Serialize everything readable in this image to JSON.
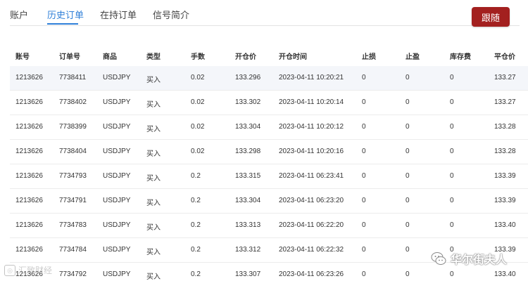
{
  "tabs": [
    {
      "label": "账户",
      "active": false
    },
    {
      "label": "历史订单",
      "active": true
    },
    {
      "label": "在持订单",
      "active": false
    },
    {
      "label": "信号简介",
      "active": false
    }
  ],
  "follow_button": {
    "label": "跟随",
    "color": "#a3201f"
  },
  "accent_color": "#2f7fd8",
  "table": {
    "columns": [
      "账号",
      "订单号",
      "商品",
      "类型",
      "手数",
      "开仓价",
      "开仓时间",
      "止损",
      "止盈",
      "库存费",
      "平仓价"
    ],
    "rows": [
      [
        "1213626",
        "7738411",
        "USDJPY",
        "买入",
        "0.02",
        "133.296",
        "2023-04-11 10:20:21",
        "0",
        "0",
        "0",
        "133.27"
      ],
      [
        "1213626",
        "7738402",
        "USDJPY",
        "买入",
        "0.02",
        "133.302",
        "2023-04-11 10:20:14",
        "0",
        "0",
        "0",
        "133.27"
      ],
      [
        "1213626",
        "7738399",
        "USDJPY",
        "买入",
        "0.02",
        "133.304",
        "2023-04-11 10:20:12",
        "0",
        "0",
        "0",
        "133.28"
      ],
      [
        "1213626",
        "7738404",
        "USDJPY",
        "买入",
        "0.02",
        "133.298",
        "2023-04-11 10:20:16",
        "0",
        "0",
        "0",
        "133.28"
      ],
      [
        "1213626",
        "7734793",
        "USDJPY",
        "买入",
        "0.2",
        "133.315",
        "2023-04-11 06:23:41",
        "0",
        "0",
        "0",
        "133.39"
      ],
      [
        "1213626",
        "7734791",
        "USDJPY",
        "买入",
        "0.2",
        "133.304",
        "2023-04-11 06:23:20",
        "0",
        "0",
        "0",
        "133.39"
      ],
      [
        "1213626",
        "7734783",
        "USDJPY",
        "买入",
        "0.2",
        "133.313",
        "2023-04-11 06:22:20",
        "0",
        "0",
        "0",
        "133.40"
      ],
      [
        "1213626",
        "7734784",
        "USDJPY",
        "买入",
        "0.2",
        "133.312",
        "2023-04-11 06:22:32",
        "0",
        "0",
        "0",
        "133.39"
      ],
      [
        "1213626",
        "7734792",
        "USDJPY",
        "买入",
        "0.2",
        "133.307",
        "2023-04-11 06:23:26",
        "0",
        "0",
        "0",
        "133.40"
      ]
    ]
  },
  "watermarks": {
    "left_text": "汇致财经",
    "right_text": "华尔街夫人"
  }
}
